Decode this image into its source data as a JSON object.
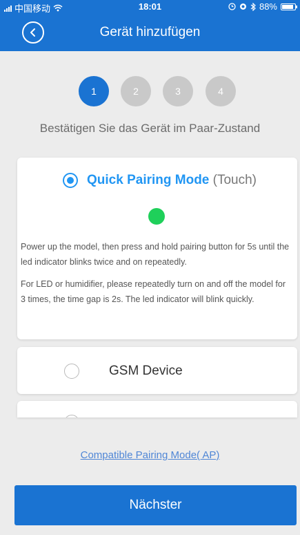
{
  "status_bar": {
    "carrier": "中国移动",
    "time": "18:01",
    "battery_percent": "88%",
    "battery_level": 0.88,
    "icons": [
      "signal-icon",
      "wifi-icon",
      "alarm-icon",
      "bluetooth-icon",
      "battery-icon"
    ]
  },
  "header": {
    "title": "Gerät hinzufügen",
    "back_icon": "back-icon"
  },
  "steps": {
    "items": [
      "1",
      "2",
      "3",
      "4"
    ],
    "active": "1"
  },
  "subtitle": "Bestätigen Sie das Gerät im Paar-Zustand",
  "modes": {
    "quick": {
      "name": "Quick Pairing Mode",
      "suffix": "(Touch)",
      "selected": true,
      "led_color": "#1fd05a",
      "description_1": "Power up the model, then press and hold pairing button for 5s until the led indicator blinks twice and on repeatedly.",
      "description_2": "For LED or humidifier, please repeatedly turn on and off the model for 3 times, the time gap is 2s. The led indicator will blink quickly."
    },
    "gsm": {
      "name": "GSM Device",
      "selected": false
    }
  },
  "compatible_link": "Compatible Pairing Mode( AP)",
  "next_button": "Nächster",
  "colors": {
    "primary": "#1a73d2",
    "accent": "#2196f3",
    "inactive_step": "#c9c9c9"
  }
}
